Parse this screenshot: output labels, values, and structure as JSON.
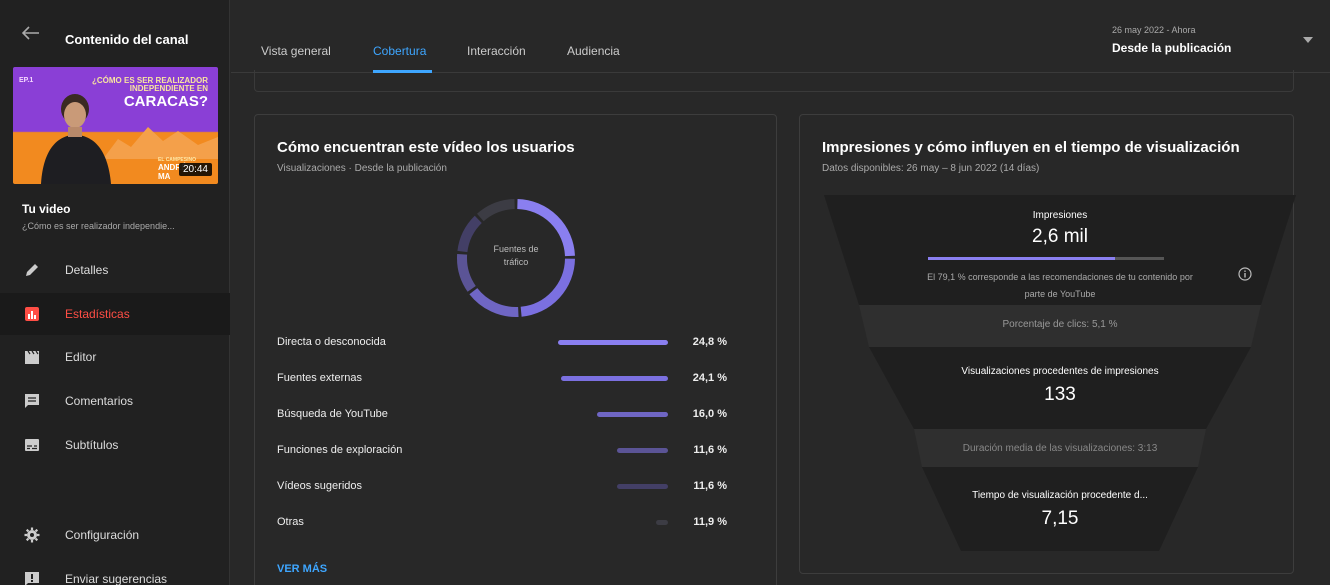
{
  "sidebar": {
    "title": "Contenido del canal",
    "thumbnail": {
      "ep": "EP.1",
      "line1": "¿CÓMO ES SER REALIZADOR",
      "line2": "INDEPENDIENTE EN",
      "line3": "CARACAS?",
      "small1": "EL CAMPESINO",
      "small2": "ANDRÉS",
      "small3": "MA",
      "duration": "20:44"
    },
    "your_video": "Tu video",
    "video_title": "¿Cómo es ser realizador independie...",
    "items": [
      {
        "label": "Detalles",
        "icon": "pencil-icon"
      },
      {
        "label": "Estadísticas",
        "icon": "analytics-icon"
      },
      {
        "label": "Editor",
        "icon": "clapper-icon"
      },
      {
        "label": "Comentarios",
        "icon": "comment-icon"
      },
      {
        "label": "Subtítulos",
        "icon": "subtitles-icon"
      },
      {
        "label": "Configuración",
        "icon": "gear-icon"
      },
      {
        "label": "Enviar sugerencias",
        "icon": "feedback-icon"
      }
    ]
  },
  "header": {
    "tabs": [
      "Vista general",
      "Cobertura",
      "Interacción",
      "Audiencia"
    ],
    "active_tab": "Cobertura",
    "date_sub": "26 may 2022 - Ahora",
    "date_main": "Desde la publicación"
  },
  "traffic": {
    "title": "Cómo encuentran este vídeo los usuarios",
    "subtitle": "Visualizaciones · Desde la publicación",
    "donut_label_1": "Fuentes de",
    "donut_label_2": "tráfico",
    "sources": [
      {
        "label": "Directa o desconocida",
        "value": "24,8 %",
        "pct": 24.8,
        "color": "#8a7ff0"
      },
      {
        "label": "Fuentes externas",
        "value": "24,1 %",
        "pct": 24.1,
        "color": "#7b70e0"
      },
      {
        "label": "Búsqueda de YouTube",
        "value": "16,0 %",
        "pct": 16.0,
        "color": "#6f66c4"
      },
      {
        "label": "Funciones de exploración",
        "value": "11,6 %",
        "pct": 11.6,
        "color": "#5b5496"
      },
      {
        "label": "Vídeos sugeridos",
        "value": "11,6 %",
        "pct": 11.6,
        "color": "#433f66"
      },
      {
        "label": "Otras",
        "value": "11,9 %",
        "pct": 11.9,
        "color": "#3c3c44"
      }
    ],
    "more": "VER MÁS"
  },
  "impressions": {
    "title": "Impresiones y cómo influyen en el tiempo de visualización",
    "subtitle": "Datos disponibles: 26 may – 8 jun 2022 (14 días)",
    "imp_label": "Impresiones",
    "imp_value": "2,6 mil",
    "imp_reco_pct": 79.1,
    "reco_line1": "El 79,1 % corresponde a las recomendaciones de tu contenido por",
    "reco_line2": "parte de YouTube",
    "ctr": "Porcentaje de clics: 5,1 %",
    "views_label": "Visualizaciones procedentes de impresiones",
    "views_value": "133",
    "avg_duration": "Duración media de las visualizaciones: 3:13",
    "watch_label": "Tiempo de visualización procedente d...",
    "watch_value": "7,15"
  }
}
